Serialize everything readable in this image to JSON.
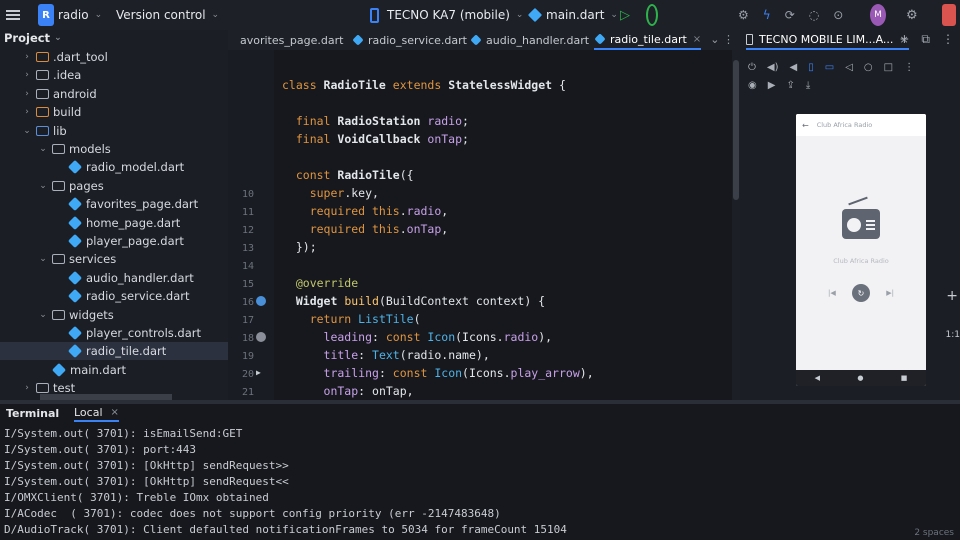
{
  "toolbar": {
    "project_badge": "R",
    "project_name": "radio",
    "vcs_label": "Version control",
    "device_label": "TECNO KA7 (mobile)",
    "run_config": "main.dart",
    "avatar_initial": "M",
    "run_icon": "play-icon",
    "debug_icon": "debug-icon",
    "right_icons": [
      "build-icon",
      "hot-reload-icon",
      "hot-restart-icon",
      "profile-icon",
      "stop-icon",
      "flutter-inspector-icon"
    ]
  },
  "project_panel": {
    "title": "Project",
    "items": [
      {
        "label": ".dart_tool",
        "indent": 1,
        "twisty": "›",
        "icon": "folder-orange"
      },
      {
        "label": ".idea",
        "indent": 1,
        "twisty": "›",
        "icon": "folder"
      },
      {
        "label": "android",
        "indent": 1,
        "twisty": "›",
        "icon": "folder"
      },
      {
        "label": "build",
        "indent": 1,
        "twisty": "›",
        "icon": "folder-orange"
      },
      {
        "label": "lib",
        "indent": 1,
        "twisty": "⌄",
        "icon": "folder-blue"
      },
      {
        "label": "models",
        "indent": 2,
        "twisty": "⌄",
        "icon": "folder"
      },
      {
        "label": "radio_model.dart",
        "indent": 3,
        "twisty": "",
        "icon": "dart"
      },
      {
        "label": "pages",
        "indent": 2,
        "twisty": "⌄",
        "icon": "folder"
      },
      {
        "label": "favorites_page.dart",
        "indent": 3,
        "twisty": "",
        "icon": "dart"
      },
      {
        "label": "home_page.dart",
        "indent": 3,
        "twisty": "",
        "icon": "dart"
      },
      {
        "label": "player_page.dart",
        "indent": 3,
        "twisty": "",
        "icon": "dart"
      },
      {
        "label": "services",
        "indent": 2,
        "twisty": "⌄",
        "icon": "folder"
      },
      {
        "label": "audio_handler.dart",
        "indent": 3,
        "twisty": "",
        "icon": "dart"
      },
      {
        "label": "radio_service.dart",
        "indent": 3,
        "twisty": "",
        "icon": "dart"
      },
      {
        "label": "widgets",
        "indent": 2,
        "twisty": "⌄",
        "icon": "folder"
      },
      {
        "label": "player_controls.dart",
        "indent": 3,
        "twisty": "",
        "icon": "dart"
      },
      {
        "label": "radio_tile.dart",
        "indent": 3,
        "twisty": "",
        "icon": "dart",
        "selected": true
      },
      {
        "label": "main.dart",
        "indent": 2,
        "twisty": "",
        "icon": "dart"
      },
      {
        "label": "test",
        "indent": 1,
        "twisty": "›",
        "icon": "folder"
      }
    ]
  },
  "editor_tabs": [
    {
      "label": "avorites_page.dart",
      "active": false
    },
    {
      "label": "radio_service.dart",
      "active": false
    },
    {
      "label": "audio_handler.dart",
      "active": false
    },
    {
      "label": "radio_tile.dart",
      "active": true
    }
  ],
  "gutter": {
    "line_numbers": [
      "",
      "",
      "",
      "",
      "",
      "",
      "",
      "",
      "10",
      "11",
      "12",
      "13",
      "14",
      "15",
      "16",
      "17",
      "18",
      "19",
      "20",
      "21"
    ]
  },
  "code_lines": [
    {
      "tokens": [
        [
          "kw",
          "class "
        ],
        [
          "ty",
          "RadioTile "
        ],
        [
          "kw",
          "extends "
        ],
        [
          "ty",
          "StatelessWidget "
        ],
        [
          "nm",
          "{"
        ]
      ]
    },
    {
      "tokens": []
    },
    {
      "tokens": [
        [
          "kw",
          "  final "
        ],
        [
          "ty",
          "RadioStation "
        ],
        [
          "prop",
          "radio"
        ],
        [
          "nm",
          ";"
        ]
      ]
    },
    {
      "tokens": [
        [
          "kw",
          "  final "
        ],
        [
          "ty",
          "VoidCallback "
        ],
        [
          "prop",
          "onTap"
        ],
        [
          "nm",
          ";"
        ]
      ]
    },
    {
      "tokens": []
    },
    {
      "tokens": [
        [
          "kw",
          "  const "
        ],
        [
          "ty",
          "RadioTile"
        ],
        [
          "nm",
          "({"
        ]
      ]
    },
    {
      "tokens": [
        [
          "kw",
          "    super"
        ],
        [
          "nm",
          ".key,"
        ]
      ]
    },
    {
      "tokens": [
        [
          "kw",
          "    required this"
        ],
        [
          "nm",
          "."
        ],
        [
          "prop",
          "radio"
        ],
        [
          "nm",
          ","
        ]
      ]
    },
    {
      "tokens": [
        [
          "kw",
          "    required this"
        ],
        [
          "nm",
          "."
        ],
        [
          "prop",
          "onTap"
        ],
        [
          "nm",
          ","
        ]
      ]
    },
    {
      "tokens": [
        [
          "nm",
          "  });"
        ]
      ]
    },
    {
      "tokens": []
    },
    {
      "tokens": [
        [
          "ann",
          "  @override"
        ]
      ]
    },
    {
      "tokens": [
        [
          "ty",
          "  Widget "
        ],
        [
          "fn",
          "build"
        ],
        [
          "nm",
          "(BuildContext context) {"
        ]
      ]
    },
    {
      "tokens": [
        [
          "kw",
          "    return "
        ],
        [
          "cls",
          "ListTile"
        ],
        [
          "nm",
          "("
        ]
      ]
    },
    {
      "tokens": [
        [
          "prop",
          "      leading"
        ],
        [
          "nm",
          ": "
        ],
        [
          "kw",
          "const "
        ],
        [
          "cls",
          "Icon"
        ],
        [
          "nm",
          "(Icons."
        ],
        [
          "prop",
          "radio"
        ],
        [
          "nm",
          "),"
        ]
      ]
    },
    {
      "tokens": [
        [
          "prop",
          "      title"
        ],
        [
          "nm",
          ": "
        ],
        [
          "cls",
          "Text"
        ],
        [
          "nm",
          "(radio.name),"
        ]
      ]
    },
    {
      "tokens": [
        [
          "prop",
          "      trailing"
        ],
        [
          "nm",
          ": "
        ],
        [
          "kw",
          "const "
        ],
        [
          "cls",
          "Icon"
        ],
        [
          "nm",
          "(Icons."
        ],
        [
          "prop",
          "play_arrow"
        ],
        [
          "nm",
          "),"
        ]
      ]
    },
    {
      "tokens": [
        [
          "prop",
          "      onTap"
        ],
        [
          "nm",
          ": onTap,"
        ]
      ]
    }
  ],
  "device_panel": {
    "tab_label": "TECNO MOBILE LIM...A...",
    "app_title": "Club Africa Radio",
    "station_name": "Club Africa Radio",
    "play_glyph": "↻",
    "prev_glyph": "|◀",
    "next_glyph": "▶|",
    "nav_buttons": [
      "◀",
      "●",
      "■"
    ],
    "side_plus": "+",
    "side_scale": "1:1"
  },
  "terminal": {
    "title": "Terminal",
    "tab_label": "Local",
    "lines": [
      "I/System.out( 3701): isEmailSend:GET",
      "I/System.out( 3701): port:443",
      "I/System.out( 3701): [OkHttp] sendRequest>>",
      "I/System.out( 3701): [OkHttp] sendRequest<<",
      "I/OMXClient( 3701): Treble IOmx obtained",
      "I/ACodec  ( 3701): codec does not support config priority (err -2147483648)",
      "D/AudioTrack( 3701): Client defaulted notificationFrames to 5034 for frameCount 15104"
    ],
    "footer_hint": "2 spaces"
  },
  "colors": {
    "accent": "#3b82f6",
    "keyword": "#e0953e",
    "class_ref": "#4fb3e6",
    "property": "#c8a0e8",
    "run_green": "#2fb24c"
  }
}
